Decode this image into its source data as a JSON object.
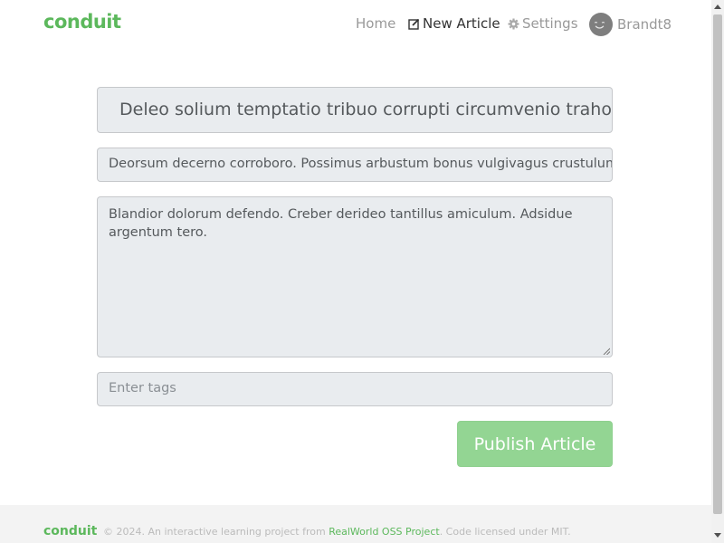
{
  "navbar": {
    "brand": "conduit",
    "links": {
      "home": "Home",
      "new_article": "New Article",
      "settings": "Settings",
      "username": "Brandt8"
    },
    "icons": {
      "new_article": "edit-icon",
      "settings": "gear-icon",
      "user": "avatar-smiley-icon"
    }
  },
  "editor": {
    "title_value": "Deleo solium temptatio tribuo corrupti circumvenio traho adn",
    "about_value": "Deorsum decerno corroboro. Possimus arbustum bonus vulgivagus crustulum ca",
    "body_value": "Blandior dolorum defendo. Creber derideo tantillus amiculum. Adsidue argentum tero.",
    "tags_placeholder": "Enter tags",
    "publish_label": "Publish Article"
  },
  "footer": {
    "brand": "conduit",
    "text_before": "© 2024. An interactive learning project from ",
    "link_text": "RealWorld OSS Project",
    "text_after": ". Code licensed under MIT."
  },
  "colors": {
    "brand_green": "#5cb85c",
    "publish_button_bg": "#93d593",
    "input_bg": "#e9ecef"
  }
}
